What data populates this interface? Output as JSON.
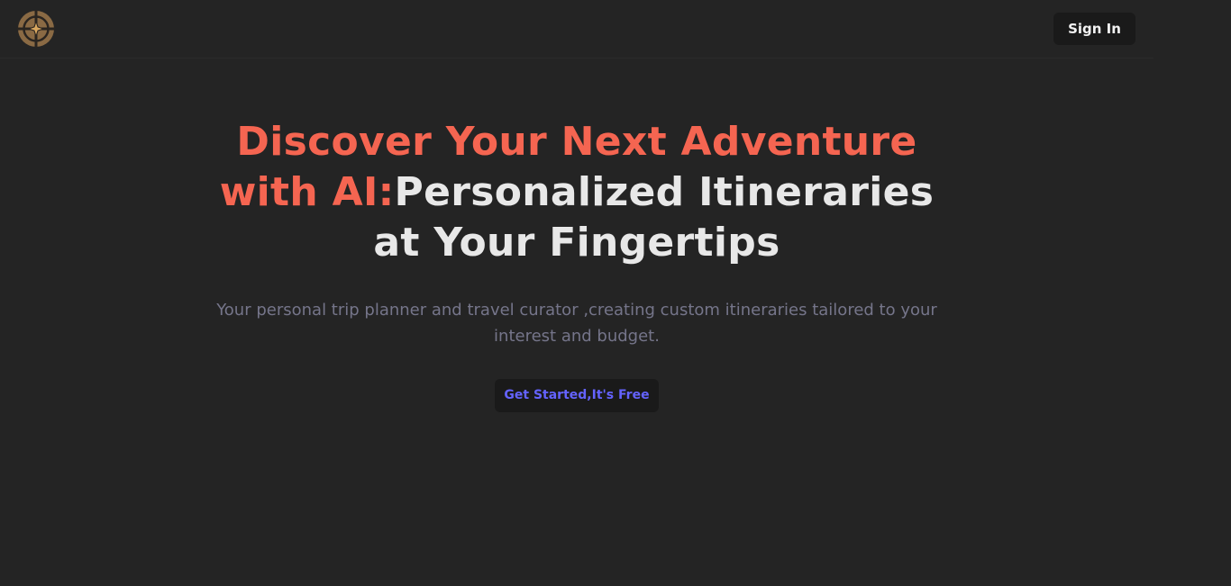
{
  "header": {
    "logo_icon": "compass-star-icon",
    "signin_label": "Sign In"
  },
  "hero": {
    "headline_accent": "Discover Your Next Adventure with AI:",
    "headline_rest": "Personalized Itineraries at Your Fingertips",
    "subtext": "Your personal trip planner and travel curator ,creating custom itineraries tailored to your interest and budget.",
    "cta_label": "Get Started,It's Free"
  },
  "colors": {
    "background": "#242424",
    "accent": "#f56551",
    "headline": "#e8e8e8",
    "subtext": "#75758a",
    "cta_text": "#6463ff",
    "button_bg": "#1a1a1a",
    "logo": "#8a6a44"
  }
}
